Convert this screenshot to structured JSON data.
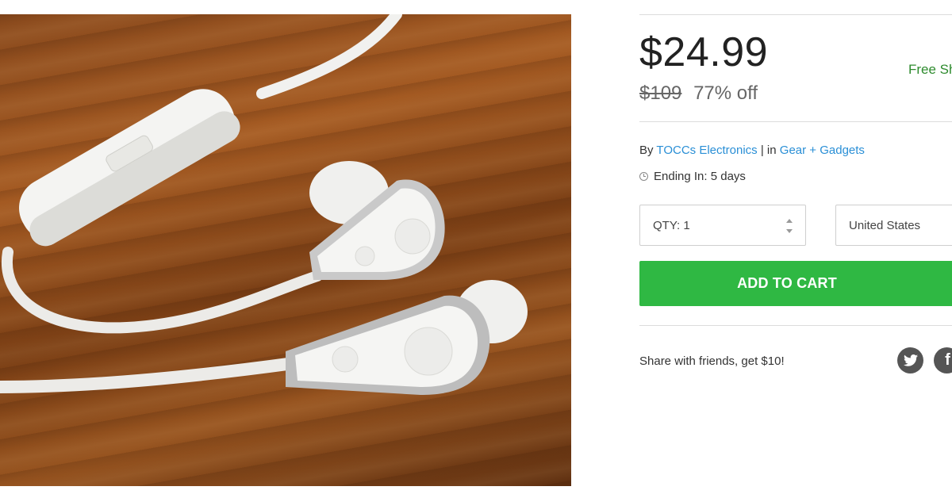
{
  "product": {
    "price": "$24.99",
    "original_price": "$109",
    "discount": "77% off",
    "shipping": "Free Sh",
    "by_prefix": "By",
    "vendor": "TOCCs Electronics",
    "separator": "| in",
    "category": "Gear + Gadgets",
    "ending": "Ending In: 5 days"
  },
  "form": {
    "qty_label": "QTY: 1",
    "country": "United States",
    "add_to_cart": "ADD TO CART"
  },
  "share": {
    "text": "Share with friends, get $10!",
    "icons": [
      "twitter-icon",
      "facebook-icon"
    ]
  },
  "colors": {
    "cart_green": "#2fb843",
    "link_blue": "#2a8fd6",
    "shipping_green": "#2e8b2e"
  }
}
